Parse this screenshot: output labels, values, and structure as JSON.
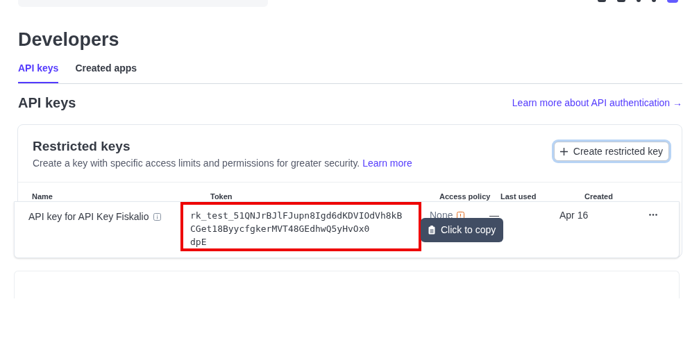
{
  "page_title": "Developers",
  "tabs": [
    {
      "label": "API keys",
      "selected": true
    },
    {
      "label": "Created apps",
      "selected": false
    }
  ],
  "section": {
    "title": "API keys",
    "link": "Learn more about API authentication →"
  },
  "card": {
    "title": "Restricted keys",
    "description": "Create a key with specific access limits and permissions for greater security.",
    "learn_more": "Learn more",
    "create_button": "Create restricted key"
  },
  "table": {
    "columns": [
      "Name",
      "Token",
      "Access policy",
      "Last used",
      "Created"
    ],
    "rows": [
      {
        "name": "API key for API Key Fiskalio",
        "token_lines": [
          "rk_test_51QNJrBJlFJupn8Igd6dKDVIOdVh8kB",
          "CGet18ByycfgkerMVT48GEdhwQ5yHvOx0",
          "dpE"
        ],
        "highlighted": true,
        "access_policy": "None",
        "last_used": "—",
        "created": "Apr 16"
      }
    ]
  },
  "tooltip": "Click to copy"
}
